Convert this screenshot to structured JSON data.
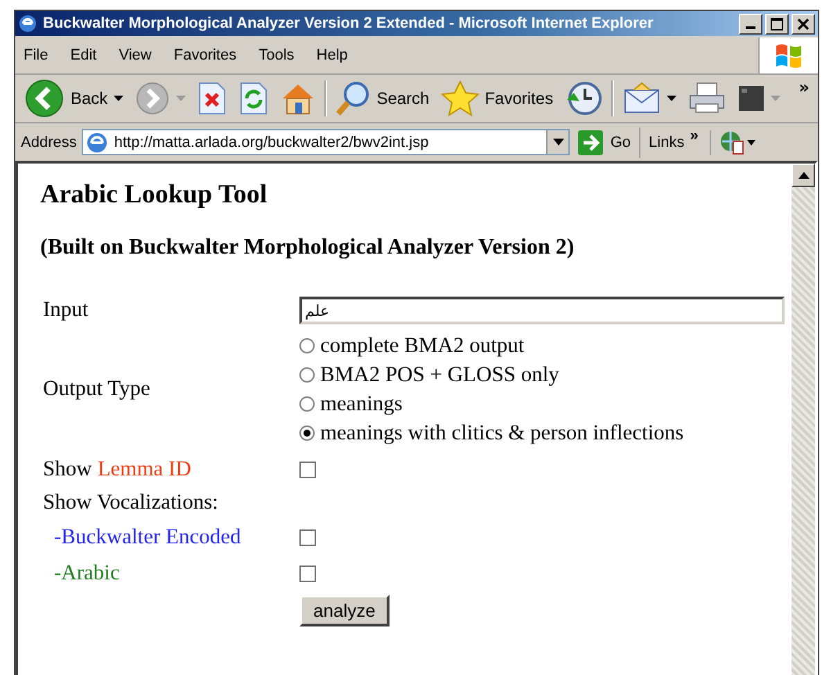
{
  "window": {
    "title": "Buckwalter Morphological Analyzer Version 2 Extended - Microsoft Internet Explorer"
  },
  "menu": [
    "File",
    "Edit",
    "View",
    "Favorites",
    "Tools",
    "Help"
  ],
  "toolbar": [
    {
      "kind": "back",
      "label": "Back"
    },
    {
      "kind": "forward"
    },
    {
      "kind": "stop"
    },
    {
      "kind": "refresh"
    },
    {
      "kind": "home"
    },
    {
      "kind": "search",
      "label": "Search"
    },
    {
      "kind": "favorites",
      "label": "Favorites"
    },
    {
      "kind": "history"
    },
    {
      "kind": "mail"
    },
    {
      "kind": "print"
    },
    {
      "kind": "square"
    }
  ],
  "toolbar_more": "»",
  "address_bar": {
    "label": "Address",
    "url": "http://matta.arlada.org/buckwalter2/bwv2int.jsp",
    "go": "Go",
    "links": "Links",
    "links_more": "»"
  },
  "page": {
    "heading": "Arabic Lookup Tool",
    "subheading": "(Built on Buckwalter Morphological Analyzer Version 2)",
    "input": {
      "label": "Input",
      "value": "علم"
    },
    "output_type": {
      "label": "Output Type",
      "options": [
        {
          "label": "complete BMA2 output",
          "selected": false
        },
        {
          "label": "BMA2 POS + GLOSS only",
          "selected": false
        },
        {
          "label": "meanings",
          "selected": false
        },
        {
          "label": "meanings with clitics & person inflections",
          "selected": true
        }
      ]
    },
    "options": [
      {
        "kind": "checkbox",
        "prefix": "Show",
        "label": "Lemma ID",
        "color": "#f03c14",
        "checked": false
      },
      {
        "kind": "heading",
        "label": "Show Vocalizations:"
      },
      {
        "kind": "checkbox",
        "label": "-Buckwalter Encoded",
        "color": "#2323f0",
        "checked": false
      },
      {
        "kind": "checkbox",
        "label": "-Arabic",
        "color": "#1e7d1e",
        "checked": false
      }
    ],
    "button": "analyze"
  }
}
